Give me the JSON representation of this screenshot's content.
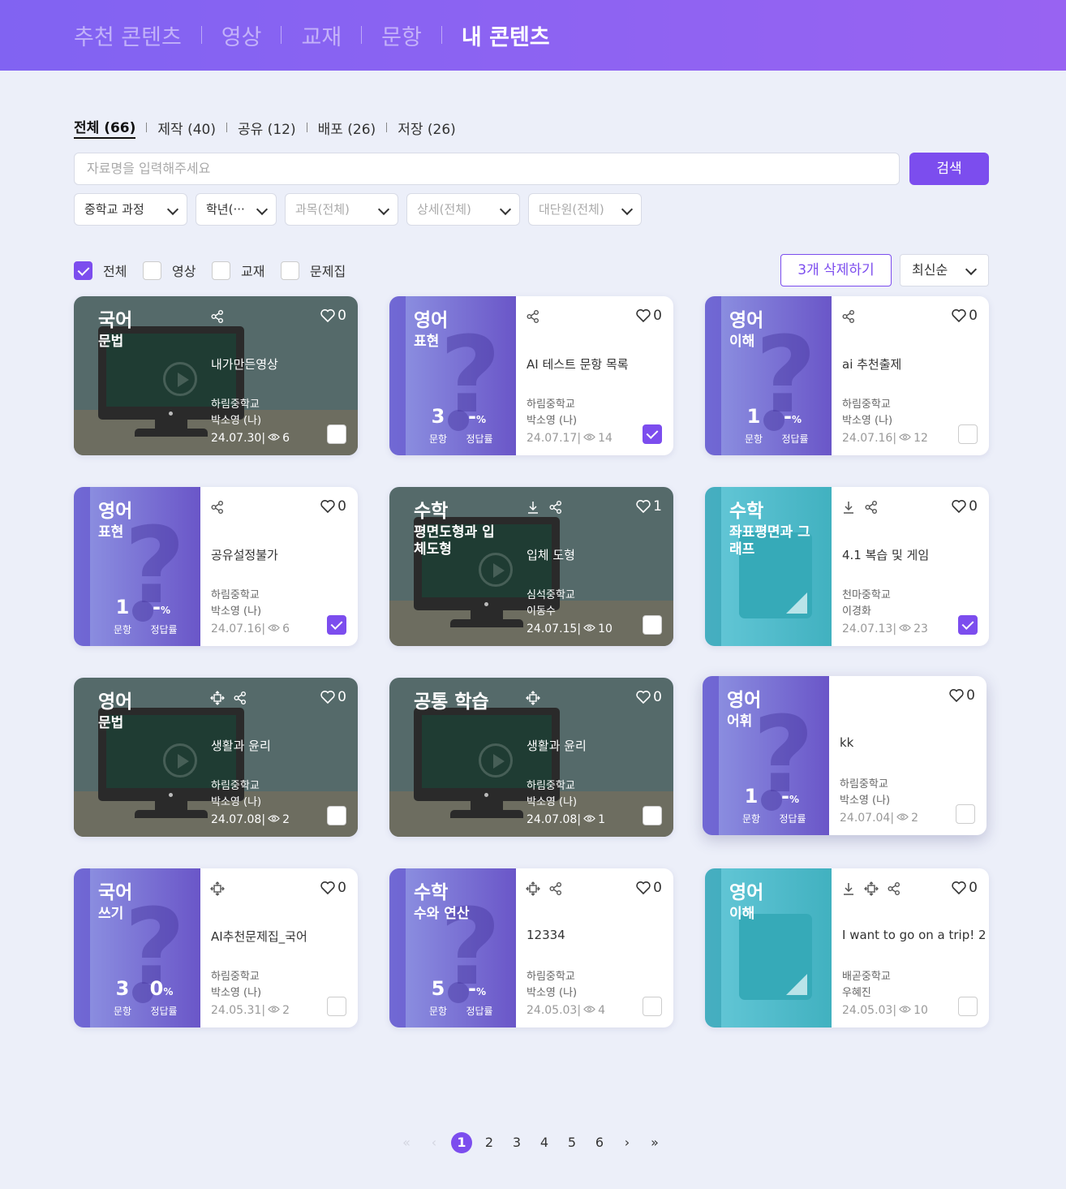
{
  "nav": {
    "items": [
      "추천 콘텐츠",
      "영상",
      "교재",
      "문항",
      "내 콘텐츠"
    ],
    "active_index": 4
  },
  "tabs": [
    {
      "label": "전체 (66)",
      "active": true
    },
    {
      "label": "제작 (40)",
      "active": false
    },
    {
      "label": "공유 (12)",
      "active": false
    },
    {
      "label": "배포 (26)",
      "active": false
    },
    {
      "label": "저장 (26)",
      "active": false
    }
  ],
  "search": {
    "placeholder": "자료명을 입력해주세요",
    "button_label": "검색"
  },
  "filters": {
    "selects": [
      {
        "value": "중학교 과정",
        "disabled": false
      },
      {
        "value": "학년(···",
        "disabled": false
      },
      {
        "value": "과목(전체)",
        "disabled": true
      },
      {
        "value": "상세(전체)",
        "disabled": true
      },
      {
        "value": "대단원(전체)",
        "disabled": true
      }
    ],
    "types": [
      {
        "label": "전체",
        "checked": true
      },
      {
        "label": "영상",
        "checked": false
      },
      {
        "label": "교재",
        "checked": false
      },
      {
        "label": "문제집",
        "checked": false
      }
    ]
  },
  "actions": {
    "delete_label": "3개 삭제하기",
    "sort_value": "최신순"
  },
  "labels": {
    "question_count": "문항",
    "correct_rate": "정답률",
    "percent": "%"
  },
  "accent_color": "#7c4dee",
  "cards": [
    {
      "kind": "video",
      "subject": "국어",
      "topic": "문법",
      "icons": [
        "share-icon"
      ],
      "likes": "0",
      "title": "내가만든영상",
      "school": "하림중학교",
      "author": "박소영 (나)",
      "date": "24.07.30",
      "views": "6",
      "checked": false
    },
    {
      "kind": "question",
      "subject": "영어",
      "topic": "표현",
      "icons": [
        "share-icon"
      ],
      "likes": "0",
      "title": "AI 테스트 문항 목록",
      "school": "하림중학교",
      "author": "박소영 (나)",
      "date": "24.07.17",
      "views": "14",
      "checked": true,
      "count": "3",
      "rate": "-"
    },
    {
      "kind": "question",
      "subject": "영어",
      "topic": "이해",
      "icons": [
        "share-icon"
      ],
      "likes": "0",
      "title": "ai 추천출제",
      "school": "하림중학교",
      "author": "박소영 (나)",
      "date": "24.07.16",
      "views": "12",
      "checked": false,
      "count": "1",
      "rate": "-"
    },
    {
      "kind": "question",
      "subject": "영어",
      "topic": "표현",
      "icons": [
        "share-icon"
      ],
      "likes": "0",
      "title": "공유설정불가",
      "school": "하림중학교",
      "author": "박소영 (나)",
      "date": "24.07.16",
      "views": "6",
      "checked": true,
      "count": "1",
      "rate": "-"
    },
    {
      "kind": "video",
      "subject": "수학",
      "topic": "평면도형과 입체도형",
      "icons": [
        "download-icon",
        "share-icon"
      ],
      "likes": "1",
      "title": "입체 도형",
      "school": "심석중학교",
      "author": "이동수",
      "date": "24.07.15",
      "views": "10",
      "checked": false
    },
    {
      "kind": "book",
      "subject": "수학",
      "topic": "좌표평면과 그래프",
      "icons": [
        "download-icon",
        "share-icon"
      ],
      "likes": "0",
      "title": "4.1 복습 및 게임",
      "school": "천마중학교",
      "author": "이경화",
      "date": "24.07.13",
      "views": "23",
      "checked": true
    },
    {
      "kind": "video",
      "subject": "영어",
      "topic": "문법",
      "icons": [
        "move-icon",
        "share-icon"
      ],
      "likes": "0",
      "title": "생활과 윤리",
      "school": "하림중학교",
      "author": "박소영 (나)",
      "date": "24.07.08",
      "views": "2",
      "checked": false
    },
    {
      "kind": "video",
      "subject": "공통 학습",
      "topic": "",
      "icons": [
        "move-icon"
      ],
      "likes": "0",
      "title": "생활과 윤리",
      "school": "하림중학교",
      "author": "박소영 (나)",
      "date": "24.07.08",
      "views": "1",
      "checked": false
    },
    {
      "kind": "question",
      "subject": "영어",
      "topic": "어휘",
      "icons": [],
      "likes": "0",
      "title": "kk",
      "school": "하림중학교",
      "author": "박소영 (나)",
      "date": "24.07.04",
      "views": "2",
      "checked": false,
      "count": "1",
      "rate": "-",
      "raised": true
    },
    {
      "kind": "question",
      "subject": "국어",
      "topic": "쓰기",
      "icons": [
        "move-icon"
      ],
      "likes": "0",
      "title": "AI추천문제집_국어",
      "school": "하림중학교",
      "author": "박소영 (나)",
      "date": "24.05.31",
      "views": "2",
      "checked": false,
      "count": "3",
      "rate": "0"
    },
    {
      "kind": "question",
      "subject": "수학",
      "topic": "수와 연산",
      "icons": [
        "move-icon",
        "share-icon"
      ],
      "likes": "0",
      "title": "12334",
      "school": "하림중학교",
      "author": "박소영 (나)",
      "date": "24.05.03",
      "views": "4",
      "checked": false,
      "count": "5",
      "rate": "-"
    },
    {
      "kind": "book",
      "subject": "영어",
      "topic": "이해",
      "icons": [
        "download-icon",
        "move-icon",
        "share-icon"
      ],
      "likes": "0",
      "title": "I want to go on a trip! 2",
      "school": "배곧중학교",
      "author": "우혜진",
      "date": "24.05.03",
      "views": "10",
      "checked": false
    }
  ],
  "pagination": {
    "pages": [
      "1",
      "2",
      "3",
      "4",
      "5",
      "6"
    ],
    "current": "1",
    "first": "«",
    "prev": "‹",
    "next": "›",
    "last": "»"
  }
}
